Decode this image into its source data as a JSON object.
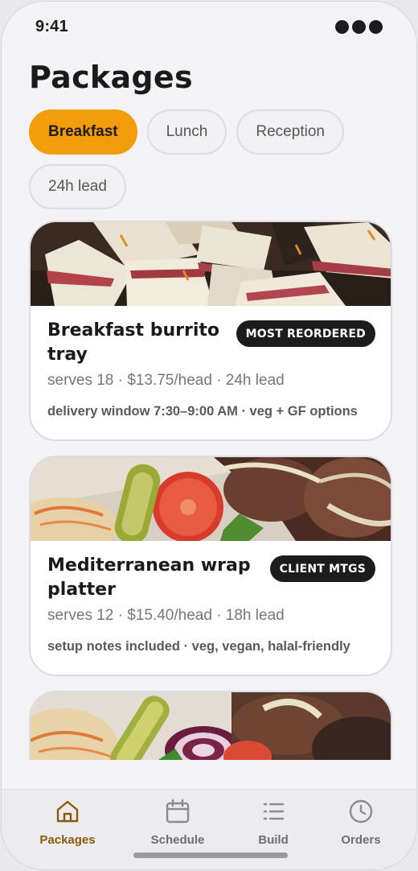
{
  "status_bar": {
    "time": "9:41"
  },
  "page": {
    "title": "Packages"
  },
  "filters": [
    {
      "label": "Breakfast",
      "active": true
    },
    {
      "label": "Lunch",
      "active": false
    },
    {
      "label": "Reception",
      "active": false
    },
    {
      "label": "24h lead",
      "active": false
    }
  ],
  "packages": [
    {
      "title": "Breakfast burrito tray",
      "badge": "MOST REORDERED",
      "meta": "serves 18 · $13.75/head · 24h lead",
      "notes": "delivery window 7:30–9:00 AM · veg + GF options"
    },
    {
      "title": "Mediterranean wrap platter",
      "badge": "CLIENT MTGS",
      "meta": "serves 12 · $15.40/head · 18h lead",
      "notes": "setup notes included · veg, vegan, halal-friendly"
    }
  ],
  "tabbar": [
    {
      "label": "Packages",
      "icon": "home-icon",
      "active": true
    },
    {
      "label": "Schedule",
      "icon": "calendar-icon",
      "active": false
    },
    {
      "label": "Build",
      "icon": "list-icon",
      "active": false
    },
    {
      "label": "Orders",
      "icon": "clock-icon",
      "active": false
    }
  ],
  "colors": {
    "accent": "#f39c0a",
    "badge": "#1c1c1e",
    "active_tab": "#8a5b08"
  }
}
